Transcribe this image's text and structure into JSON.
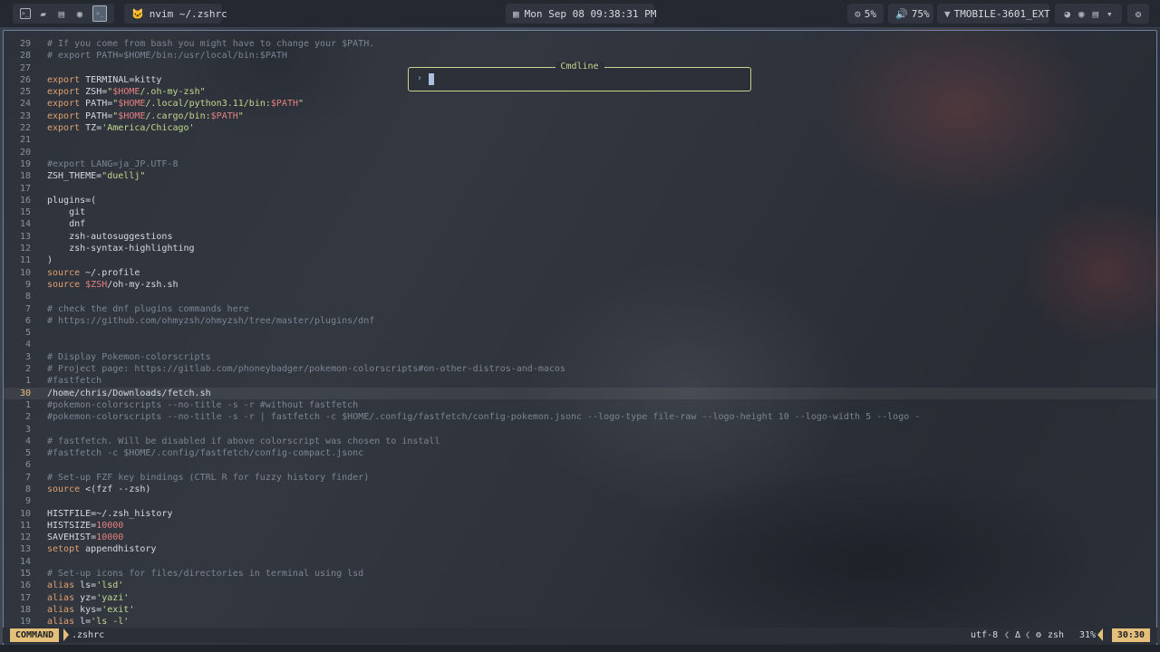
{
  "topbar": {
    "window_title": "nvim ~/.zshrc",
    "clock": "Mon Sep 08  09:38:31 PM",
    "cpu": "5%",
    "volume": "75%",
    "network": "TMOBILE-3601_EXT"
  },
  "cmdline": {
    "title": "Cmdline",
    "prompt": "›",
    "value": ""
  },
  "editor": {
    "lines": [
      {
        "n": "29",
        "segs": [
          {
            "c": "t-comment",
            "t": "# If you come from bash you might have to change your $PATH."
          }
        ]
      },
      {
        "n": "28",
        "segs": [
          {
            "c": "t-comment",
            "t": "# export PATH=$HOME/bin:/usr/local/bin:$PATH"
          }
        ]
      },
      {
        "n": "27",
        "segs": []
      },
      {
        "n": "26",
        "segs": [
          {
            "c": "t-kw",
            "t": "export "
          },
          {
            "c": "t-plain",
            "t": "TERMINAL=kitty"
          }
        ]
      },
      {
        "n": "25",
        "segs": [
          {
            "c": "t-kw",
            "t": "export "
          },
          {
            "c": "t-plain",
            "t": "ZSH="
          },
          {
            "c": "t-str",
            "t": "\""
          },
          {
            "c": "t-var",
            "t": "$HOME"
          },
          {
            "c": "t-str",
            "t": "/.oh-my-zsh\""
          }
        ]
      },
      {
        "n": "24",
        "segs": [
          {
            "c": "t-kw",
            "t": "export "
          },
          {
            "c": "t-plain",
            "t": "PATH="
          },
          {
            "c": "t-str",
            "t": "\""
          },
          {
            "c": "t-var",
            "t": "$HOME"
          },
          {
            "c": "t-str",
            "t": "/.local/python3.11/bin:"
          },
          {
            "c": "t-var",
            "t": "$PATH"
          },
          {
            "c": "t-str",
            "t": "\""
          }
        ]
      },
      {
        "n": "23",
        "segs": [
          {
            "c": "t-kw",
            "t": "export "
          },
          {
            "c": "t-plain",
            "t": "PATH="
          },
          {
            "c": "t-str",
            "t": "\""
          },
          {
            "c": "t-var",
            "t": "$HOME"
          },
          {
            "c": "t-str",
            "t": "/.cargo/bin:"
          },
          {
            "c": "t-var",
            "t": "$PATH"
          },
          {
            "c": "t-str",
            "t": "\""
          }
        ]
      },
      {
        "n": "22",
        "segs": [
          {
            "c": "t-kw",
            "t": "export "
          },
          {
            "c": "t-plain",
            "t": "TZ="
          },
          {
            "c": "t-str",
            "t": "'America/Chicago'"
          }
        ]
      },
      {
        "n": "21",
        "segs": []
      },
      {
        "n": "20",
        "segs": []
      },
      {
        "n": "19",
        "segs": [
          {
            "c": "t-comment",
            "t": "#export LANG=ja_JP.UTF-8"
          }
        ]
      },
      {
        "n": "18",
        "segs": [
          {
            "c": "t-plain",
            "t": "ZSH_THEME="
          },
          {
            "c": "t-str",
            "t": "\"duellj\""
          }
        ]
      },
      {
        "n": "17",
        "segs": []
      },
      {
        "n": "16",
        "segs": [
          {
            "c": "t-plain",
            "t": "plugins=("
          }
        ]
      },
      {
        "n": "15",
        "segs": [
          {
            "c": "t-plain",
            "t": "    git"
          }
        ]
      },
      {
        "n": "14",
        "segs": [
          {
            "c": "t-plain",
            "t": "    dnf"
          }
        ]
      },
      {
        "n": "13",
        "segs": [
          {
            "c": "t-plain",
            "t": "    zsh-autosuggestions"
          }
        ]
      },
      {
        "n": "12",
        "segs": [
          {
            "c": "t-plain",
            "t": "    zsh-syntax-highlighting"
          }
        ]
      },
      {
        "n": "11",
        "segs": [
          {
            "c": "t-plain",
            "t": ")"
          }
        ]
      },
      {
        "n": "10",
        "segs": [
          {
            "c": "t-kw",
            "t": "source "
          },
          {
            "c": "t-plain",
            "t": "~/.profile"
          }
        ]
      },
      {
        "n": "9",
        "segs": [
          {
            "c": "t-kw",
            "t": "source "
          },
          {
            "c": "t-var",
            "t": "$ZSH"
          },
          {
            "c": "t-plain",
            "t": "/oh-my-zsh.sh"
          }
        ]
      },
      {
        "n": "8",
        "segs": []
      },
      {
        "n": "7",
        "segs": [
          {
            "c": "t-comment",
            "t": "# check the dnf plugins commands here"
          }
        ]
      },
      {
        "n": "6",
        "segs": [
          {
            "c": "t-comment",
            "t": "# https://github.com/ohmyzsh/ohmyzsh/tree/master/plugins/dnf"
          }
        ]
      },
      {
        "n": "5",
        "segs": []
      },
      {
        "n": "4",
        "segs": []
      },
      {
        "n": "3",
        "segs": [
          {
            "c": "t-comment",
            "t": "# Display Pokemon-colorscripts"
          }
        ]
      },
      {
        "n": "2",
        "segs": [
          {
            "c": "t-comment",
            "t": "# Project page: https://gitlab.com/phoneybadger/pokemon-colorscripts#on-other-distros-and-macos"
          }
        ]
      },
      {
        "n": "1",
        "segs": [
          {
            "c": "t-comment",
            "t": "#fastfetch"
          }
        ]
      },
      {
        "n": "30",
        "cur": true,
        "segs": [
          {
            "c": "t-plain",
            "t": "/home/chris/Downloads/fetch.sh"
          }
        ]
      },
      {
        "n": "1",
        "segs": [
          {
            "c": "t-comment",
            "t": "#pokemon-colorscripts --no-title -s -r #without fastfetch"
          }
        ]
      },
      {
        "n": "2",
        "segs": [
          {
            "c": "t-comment",
            "t": "#pokemon-colorscripts --no-title -s -r | fastfetch -c $HOME/.config/fastfetch/config-pokemon.jsonc --logo-type file-raw --logo-height 10 --logo-width 5 --logo -"
          }
        ]
      },
      {
        "n": "3",
        "segs": []
      },
      {
        "n": "4",
        "segs": [
          {
            "c": "t-comment",
            "t": "# fastfetch. Will be disabled if above colorscript was chosen to install"
          }
        ]
      },
      {
        "n": "5",
        "segs": [
          {
            "c": "t-comment",
            "t": "#fastfetch -c $HOME/.config/fastfetch/config-compact.jsonc"
          }
        ]
      },
      {
        "n": "6",
        "segs": []
      },
      {
        "n": "7",
        "segs": [
          {
            "c": "t-comment",
            "t": "# Set-up FZF key bindings (CTRL R for fuzzy history finder)"
          }
        ]
      },
      {
        "n": "8",
        "segs": [
          {
            "c": "t-kw",
            "t": "source "
          },
          {
            "c": "t-plain",
            "t": "<(fzf --zsh)"
          }
        ]
      },
      {
        "n": "9",
        "segs": []
      },
      {
        "n": "10",
        "segs": [
          {
            "c": "t-plain",
            "t": "HISTFILE=~/.zsh_history"
          }
        ]
      },
      {
        "n": "11",
        "segs": [
          {
            "c": "t-plain",
            "t": "HISTSIZE="
          },
          {
            "c": "t-num",
            "t": "10000"
          }
        ]
      },
      {
        "n": "12",
        "segs": [
          {
            "c": "t-plain",
            "t": "SAVEHIST="
          },
          {
            "c": "t-num",
            "t": "10000"
          }
        ]
      },
      {
        "n": "13",
        "segs": [
          {
            "c": "t-kw",
            "t": "setopt "
          },
          {
            "c": "t-plain",
            "t": "appendhistory"
          }
        ]
      },
      {
        "n": "14",
        "segs": []
      },
      {
        "n": "15",
        "segs": [
          {
            "c": "t-comment",
            "t": "# Set-up icons for files/directories in terminal using lsd"
          }
        ]
      },
      {
        "n": "16",
        "segs": [
          {
            "c": "t-kw",
            "t": "alias "
          },
          {
            "c": "t-plain",
            "t": "ls="
          },
          {
            "c": "t-str",
            "t": "'lsd'"
          }
        ]
      },
      {
        "n": "17",
        "segs": [
          {
            "c": "t-kw",
            "t": "alias "
          },
          {
            "c": "t-plain",
            "t": "yz="
          },
          {
            "c": "t-str",
            "t": "'yazi'"
          }
        ]
      },
      {
        "n": "18",
        "segs": [
          {
            "c": "t-kw",
            "t": "alias "
          },
          {
            "c": "t-plain",
            "t": "kys="
          },
          {
            "c": "t-str",
            "t": "'exit'"
          }
        ]
      },
      {
        "n": "19",
        "segs": [
          {
            "c": "t-kw",
            "t": "alias "
          },
          {
            "c": "t-plain",
            "t": "l="
          },
          {
            "c": "t-str",
            "t": "'ls -l'"
          }
        ]
      }
    ]
  },
  "statusline": {
    "mode": "COMMAND",
    "filename": ".zshrc",
    "encoding": "utf-8",
    "delta": "Δ",
    "filetype": "zsh",
    "percent": "31%",
    "position": "30:30"
  },
  "colors": {
    "accent": "#e5c07b",
    "cmdline_border": "#c9d48f",
    "window_border": "#6b84a8"
  }
}
